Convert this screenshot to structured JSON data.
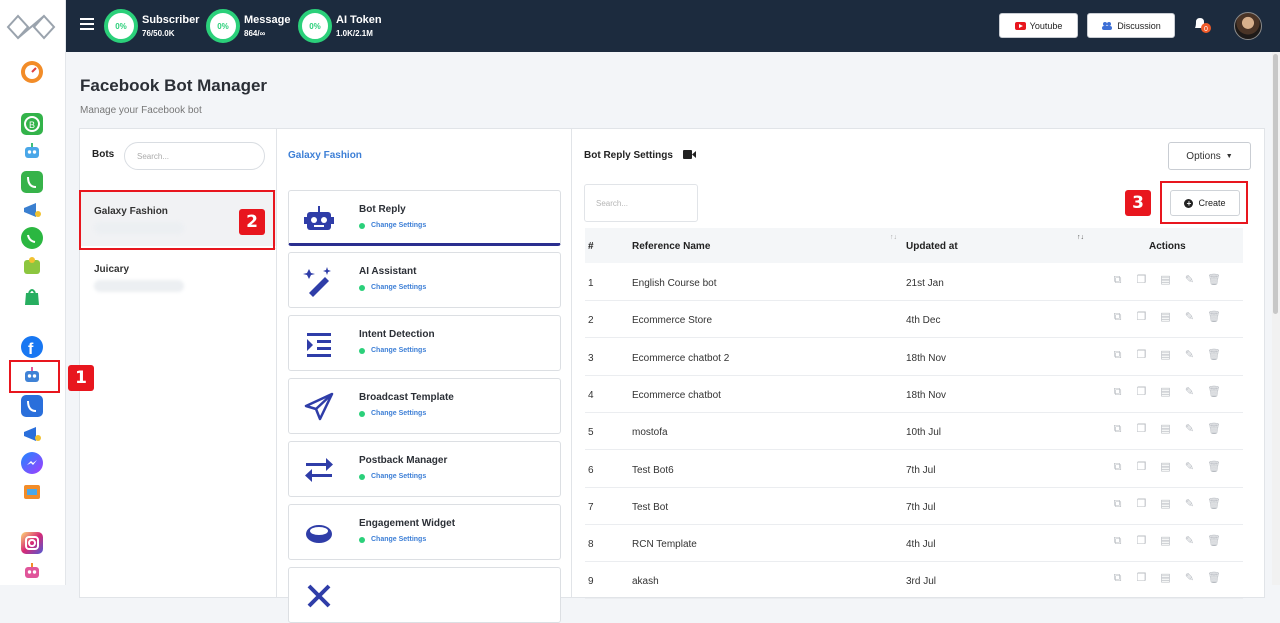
{
  "topbar": {
    "stats": [
      {
        "percent": "0%",
        "title": "Subscriber",
        "value": "76/50.0K"
      },
      {
        "percent": "0%",
        "title": "Message",
        "value": "864/∞"
      },
      {
        "percent": "0%",
        "title": "AI Token",
        "value": "1.0K/2.1M"
      }
    ],
    "youtube_label": "Youtube",
    "discussion_label": "Discussion",
    "notification_count": "0",
    "colors": {
      "bar": "#1c2b3e",
      "ring": "#2bd07a"
    }
  },
  "page": {
    "title": "Facebook Bot Manager",
    "subtitle": "Manage your Facebook bot"
  },
  "bots": {
    "label": "Bots",
    "search_placeholder": "Search...",
    "items": [
      {
        "name": "Galaxy Fashion"
      },
      {
        "name": "Juicary"
      }
    ]
  },
  "features": {
    "current_bot": "Galaxy Fashion",
    "items": [
      {
        "name": "Bot Reply",
        "sub": "Change Settings",
        "icon": "robot-icon"
      },
      {
        "name": "AI Assistant",
        "sub": "Change Settings",
        "icon": "magic-wand-icon"
      },
      {
        "name": "Intent Detection",
        "sub": "Change Settings",
        "icon": "indent-icon"
      },
      {
        "name": "Broadcast Template",
        "sub": "Change Settings",
        "icon": "paper-plane-icon"
      },
      {
        "name": "Postback Manager",
        "sub": "Change Settings",
        "icon": "exchange-icon"
      },
      {
        "name": "Engagement Widget",
        "sub": "Change Settings",
        "icon": "ring-icon"
      }
    ]
  },
  "reply": {
    "title": "Bot Reply Settings",
    "options_label": "Options",
    "search_placeholder": "Search...",
    "create_label": "Create",
    "columns": [
      "#",
      "Reference Name",
      "Updated at",
      "Actions"
    ],
    "rows": [
      {
        "num": "1",
        "name": "English Course bot",
        "updated": "21st Jan"
      },
      {
        "num": "2",
        "name": "Ecommerce Store",
        "updated": "4th Dec"
      },
      {
        "num": "3",
        "name": "Ecommerce chatbot 2",
        "updated": "18th Nov"
      },
      {
        "num": "4",
        "name": "Ecommerce chatbot",
        "updated": "18th Nov"
      },
      {
        "num": "5",
        "name": "mostofa",
        "updated": "10th Jul"
      },
      {
        "num": "6",
        "name": "Test Bot6",
        "updated": "7th Jul"
      },
      {
        "num": "7",
        "name": "Test Bot",
        "updated": "7th Jul"
      },
      {
        "num": "8",
        "name": "RCN Template",
        "updated": "4th Jul"
      },
      {
        "num": "9",
        "name": "akash",
        "updated": "3rd Jul"
      }
    ]
  },
  "annotations": [
    "1",
    "2",
    "3"
  ]
}
